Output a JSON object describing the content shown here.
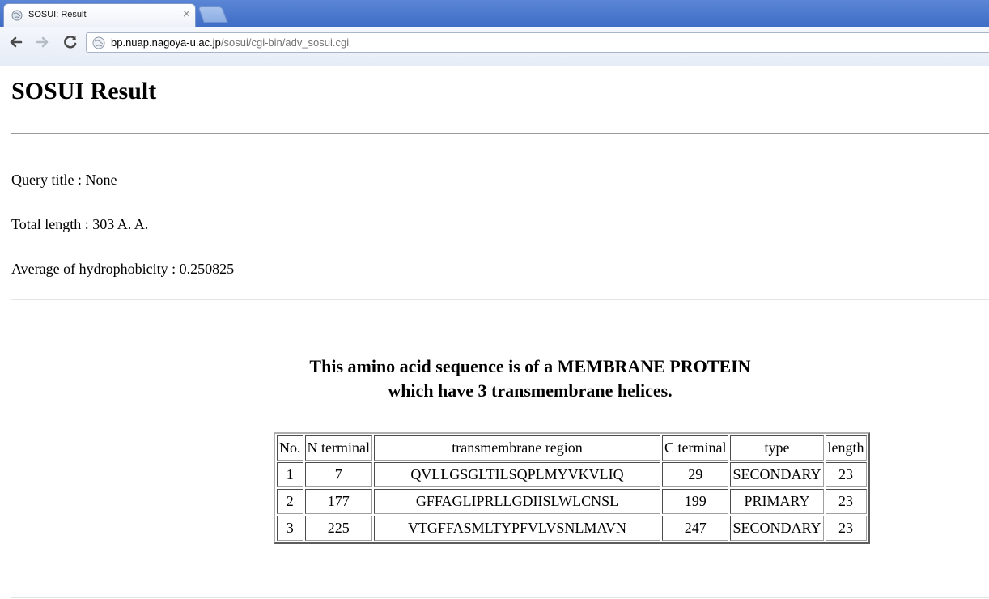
{
  "browser": {
    "tab_title": "SOSUI: Result",
    "tab_close": "×",
    "url_host": "bp.nuap.nagoya-u.ac.jp",
    "url_path": "/sosui/cgi-bin/adv_sosui.cgi"
  },
  "page": {
    "heading": "SOSUI Result",
    "query_title": "Query title : None",
    "total_length": "Total length : 303 A. A.",
    "avg_hydrophobicity": "Average of hydrophobicity : 0.250825",
    "summary_line1": "This amino acid sequence is of a MEMBRANE PROTEIN",
    "summary_line2": "which have 3 transmembrane helices."
  },
  "table": {
    "headers": [
      "No.",
      "N terminal",
      "transmembrane region",
      "C terminal",
      "type",
      "length"
    ],
    "rows": [
      [
        "1",
        "7",
        "QVLLGSGLTILSQPLMYVKVLIQ",
        "29",
        "SECONDARY",
        "23"
      ],
      [
        "2",
        "177",
        "GFFAGLIPRLLGDIISLWLCNSL",
        "199",
        "PRIMARY",
        "23"
      ],
      [
        "3",
        "225",
        "VTGFFASMLTYPFVLVSNLMAVN",
        "247",
        "SECONDARY",
        "23"
      ]
    ]
  },
  "icons": {
    "tab": "globe-icon",
    "back": "back-arrow-icon",
    "forward": "forward-arrow-icon",
    "reload": "reload-icon",
    "page_info": "globe-icon"
  }
}
